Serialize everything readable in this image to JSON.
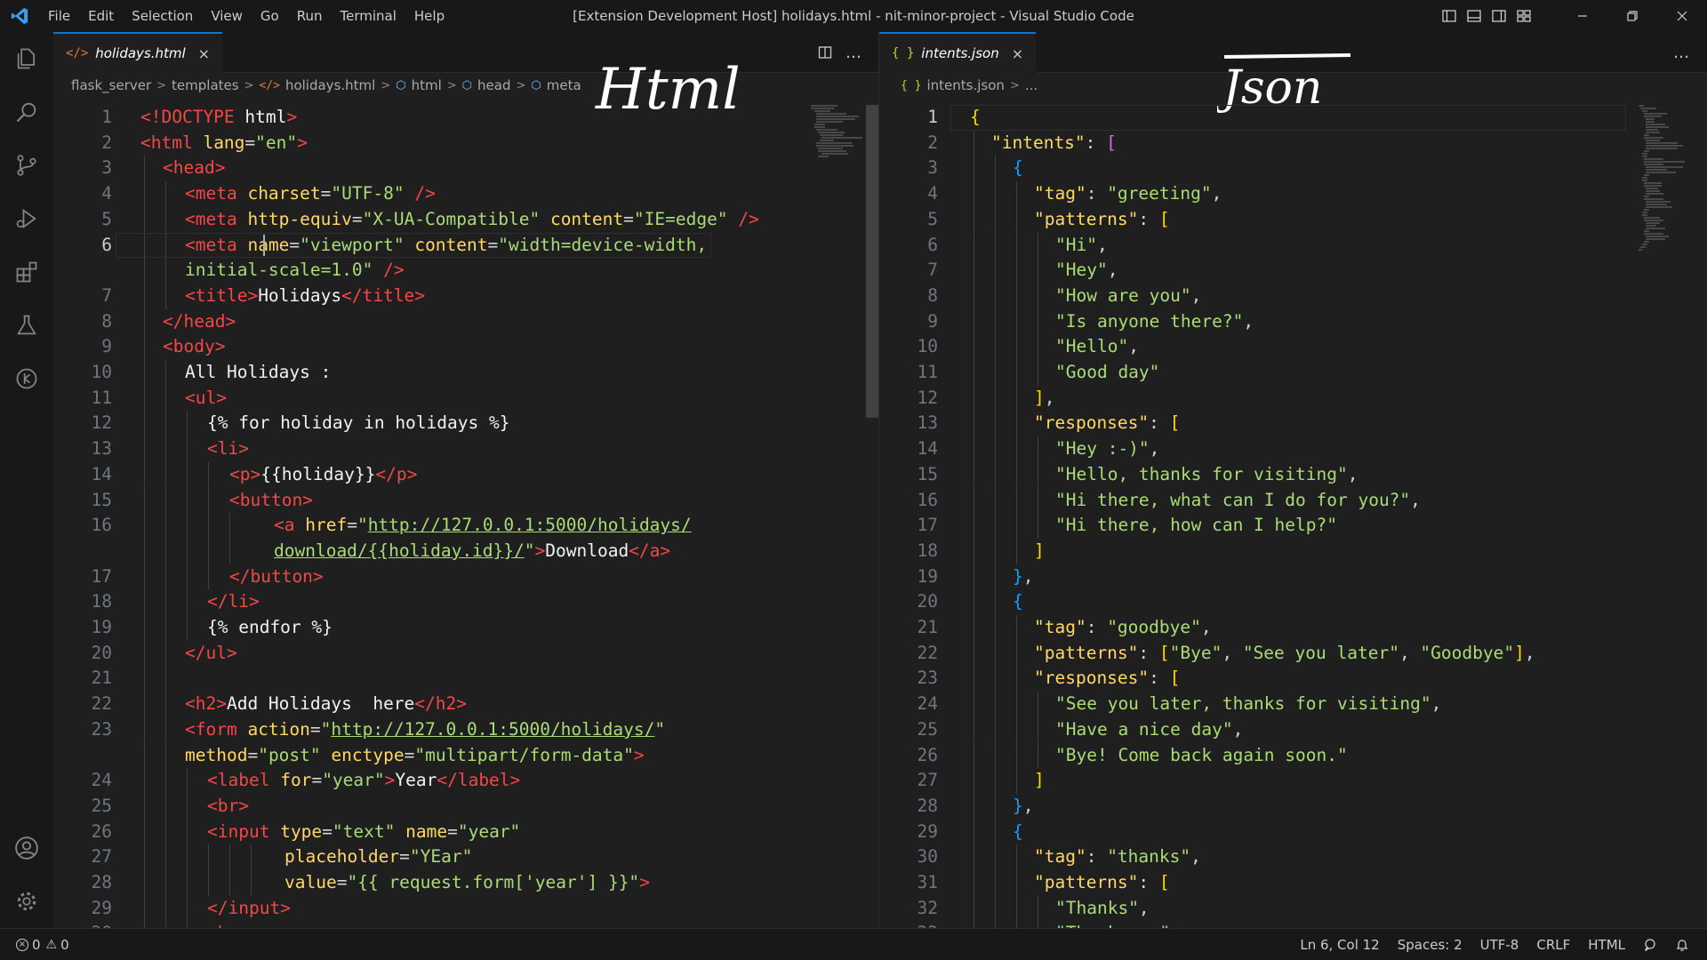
{
  "window": {
    "title": "[Extension Development Host] holidays.html - nit-minor-project - Visual Studio Code",
    "menu": [
      "File",
      "Edit",
      "Selection",
      "View",
      "Go",
      "Run",
      "Terminal",
      "Help"
    ]
  },
  "activity_bar": {
    "top_icons": [
      "explorer-icon",
      "search-icon",
      "source-control-icon",
      "run-debug-icon",
      "extensions-icon",
      "testing-icon",
      "remote-icon"
    ],
    "bottom_icons": [
      "accounts-icon",
      "settings-gear-icon"
    ]
  },
  "left_editor": {
    "tab": {
      "label": "holidays.html",
      "icon": "html-file-icon",
      "close": "×"
    },
    "breadcrumb": [
      "flask_server",
      "templates",
      "holidays.html",
      "html",
      "head",
      "meta"
    ],
    "annotation": "Html",
    "actions": [
      "split-editor-icon",
      "more-actions-icon"
    ],
    "active_line": 6
  },
  "right_editor": {
    "tab": {
      "label": "intents.json",
      "icon": "json-file-icon",
      "close": "×"
    },
    "breadcrumb": [
      "intents.json",
      "..."
    ],
    "annotation": "Json",
    "active_line": 1
  },
  "status_bar": {
    "errors": "0",
    "warnings": "0",
    "position": "Ln 6, Col 12",
    "spaces": "Spaces: 2",
    "encoding": "UTF-8",
    "eol": "CRLF",
    "language": "HTML"
  },
  "colors": {
    "accent": "#0078d4",
    "tag": "#f44747",
    "attribute": "#ffd866",
    "string": "#a9dc76",
    "bracket_gold": "#ffd700",
    "bracket_purple": "#da70d6",
    "bracket_blue": "#179fff"
  }
}
